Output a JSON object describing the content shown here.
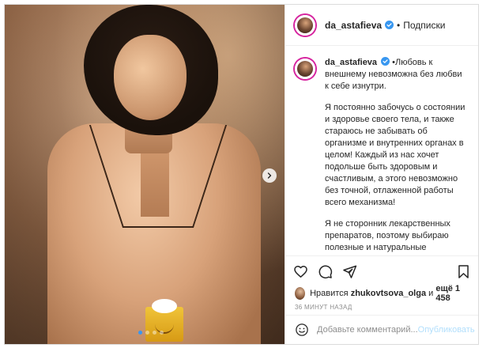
{
  "post": {
    "username": "da_astafieva",
    "header_separator": "•",
    "follow_label": "Подписки"
  },
  "caption": {
    "username": "da_astafieva",
    "intro": "•Любовь к внешнему невозможна без любви к себе изнутри.",
    "paragraph_2": "Я постоянно забочусь о состоянии и здоровье своего тела, и также стараюсь не забывать об организме и внутренних органах в целом! Каждый из нас хочет подольше быть здоровым и счастливым, а этого невозможно без точной, отлаженной работы всего механизма!",
    "paragraph_3": "Я не сторонник лекарственных препаратов, поэтому выбираю полезные и натуральные компоненты, которые поддерживают иммунитет, дают заряд сил и"
  },
  "likes": {
    "prefix": "Нравится",
    "user": "zhukovtsova_olga",
    "middle": "и",
    "more": "ещё 1 458"
  },
  "timestamp": "36 МИНУТ НАЗАД",
  "comment": {
    "placeholder": "Добавьте комментарий...",
    "post_label": "Опубликовать"
  },
  "carousel": {
    "slide_count": 4,
    "active_index": 0
  },
  "colors": {
    "accent": "#3897f0",
    "post_disabled": "#b2dffc",
    "muted": "#8e8e8e",
    "text": "#262626"
  },
  "icons": [
    "verified-badge-icon",
    "chevron-right-icon",
    "heart-icon",
    "comment-icon",
    "share-icon",
    "bookmark-icon",
    "emoji-icon"
  ]
}
